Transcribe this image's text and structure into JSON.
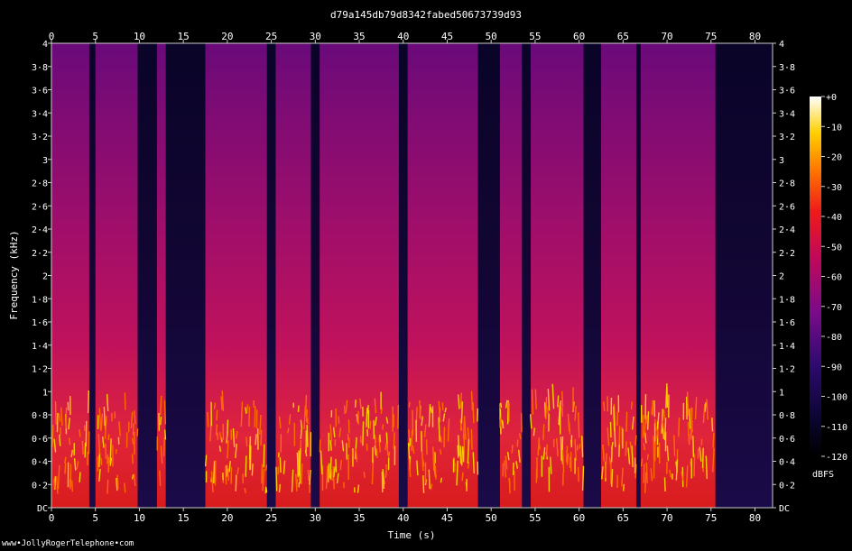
{
  "chart_data": {
    "type": "heatmap",
    "title": "d79a145db79d8342fabed50673739d93",
    "xlabel": "Time (s)",
    "ylabel": "Frequency (kHz)",
    "xlim": [
      0,
      82
    ],
    "ylim": [
      0,
      4
    ],
    "x_ticks": [
      "0",
      "5",
      "10",
      "15",
      "20",
      "25",
      "30",
      "35",
      "40",
      "45",
      "50",
      "55",
      "60",
      "65",
      "70",
      "75",
      "80"
    ],
    "y_ticks": [
      "DC",
      "0·2",
      "0·4",
      "0·6",
      "0·8",
      "1",
      "1·2",
      "1·4",
      "1·6",
      "1·8",
      "2",
      "2·2",
      "2·4",
      "2·6",
      "2·8",
      "3",
      "3·2",
      "3·4",
      "3·6",
      "3·8",
      "4"
    ],
    "colorbar": {
      "label": "dBFS",
      "range": [
        -120,
        0
      ],
      "ticks": [
        "+0",
        "-10",
        "-20",
        "-30",
        "-40",
        "-50",
        "-60",
        "-70",
        "-80",
        "-90",
        "-100",
        "-110",
        "-120"
      ]
    },
    "speech_segments_s": [
      [
        0,
        4.3
      ],
      [
        5,
        9.8
      ],
      [
        12,
        13
      ],
      [
        17.5,
        24.5
      ],
      [
        25.5,
        29.5
      ],
      [
        30.5,
        39.5
      ],
      [
        40.5,
        48.5
      ],
      [
        51,
        53.5
      ],
      [
        54.5,
        60.5
      ],
      [
        62.5,
        66.5
      ],
      [
        67,
        75.5
      ]
    ],
    "quiet_segments_s": [
      [
        4.3,
        5
      ],
      [
        9.8,
        12
      ],
      [
        13,
        17.5
      ],
      [
        24.5,
        25.5
      ],
      [
        29.5,
        30.5
      ],
      [
        39.5,
        40.5
      ],
      [
        48.5,
        51
      ],
      [
        53.5,
        54.5
      ],
      [
        60.5,
        62.5
      ],
      [
        66.5,
        67
      ],
      [
        75.5,
        82
      ]
    ],
    "grid": false
  },
  "footer": {
    "text": "www•JollyRogerTelephone•com"
  }
}
